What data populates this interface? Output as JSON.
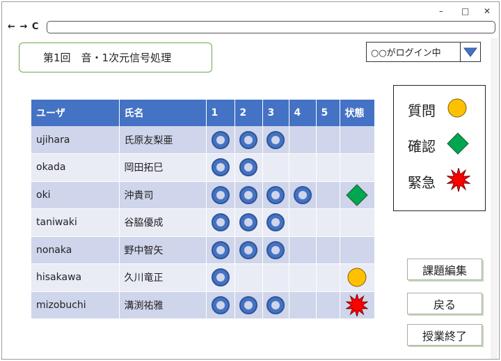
{
  "window": {
    "minimize": "–",
    "maximize": "□",
    "close": "✕"
  },
  "nav": {
    "back": "←",
    "forward": "→",
    "reload": "C"
  },
  "address": {
    "value": ""
  },
  "title": "第1回　音・1次元信号処理",
  "login": {
    "text": "○○がログイン中"
  },
  "table": {
    "headers": {
      "user": "ユーザ",
      "name": "氏名",
      "c1": "1",
      "c2": "2",
      "c3": "3",
      "c4": "4",
      "c5": "5",
      "status": "状態"
    },
    "rows": [
      {
        "user": "ujihara",
        "name": "氏原友梨亜",
        "done": [
          1,
          1,
          1,
          0,
          0
        ],
        "status": ""
      },
      {
        "user": "okada",
        "name": "岡田拓巳",
        "done": [
          1,
          1,
          0,
          0,
          0
        ],
        "status": ""
      },
      {
        "user": "oki",
        "name": "沖貴司",
        "done": [
          1,
          1,
          1,
          1,
          0
        ],
        "status": "confirm"
      },
      {
        "user": "taniwaki",
        "name": "谷脇優成",
        "done": [
          1,
          1,
          1,
          0,
          0
        ],
        "status": ""
      },
      {
        "user": "nonaka",
        "name": "野中智矢",
        "done": [
          1,
          1,
          1,
          0,
          0
        ],
        "status": ""
      },
      {
        "user": "hisakawa",
        "name": "久川竜正",
        "done": [
          1,
          0,
          0,
          0,
          0
        ],
        "status": "question"
      },
      {
        "user": "mizobuchi",
        "name": "溝渕祐雅",
        "done": [
          1,
          1,
          1,
          0,
          0
        ],
        "status": "urgent"
      }
    ]
  },
  "legend": {
    "question": "質問",
    "confirm": "確認",
    "urgent": "緊急"
  },
  "colors": {
    "question": "#ffc000",
    "confirm": "#00a650",
    "urgent": "#ff0000",
    "header": "#4472c4"
  },
  "icons": {
    "question": "circle-icon",
    "confirm": "diamond-icon",
    "urgent": "starburst-icon"
  },
  "buttons": {
    "edit": "課題編集",
    "back": "戻る",
    "end": "授業終了"
  }
}
